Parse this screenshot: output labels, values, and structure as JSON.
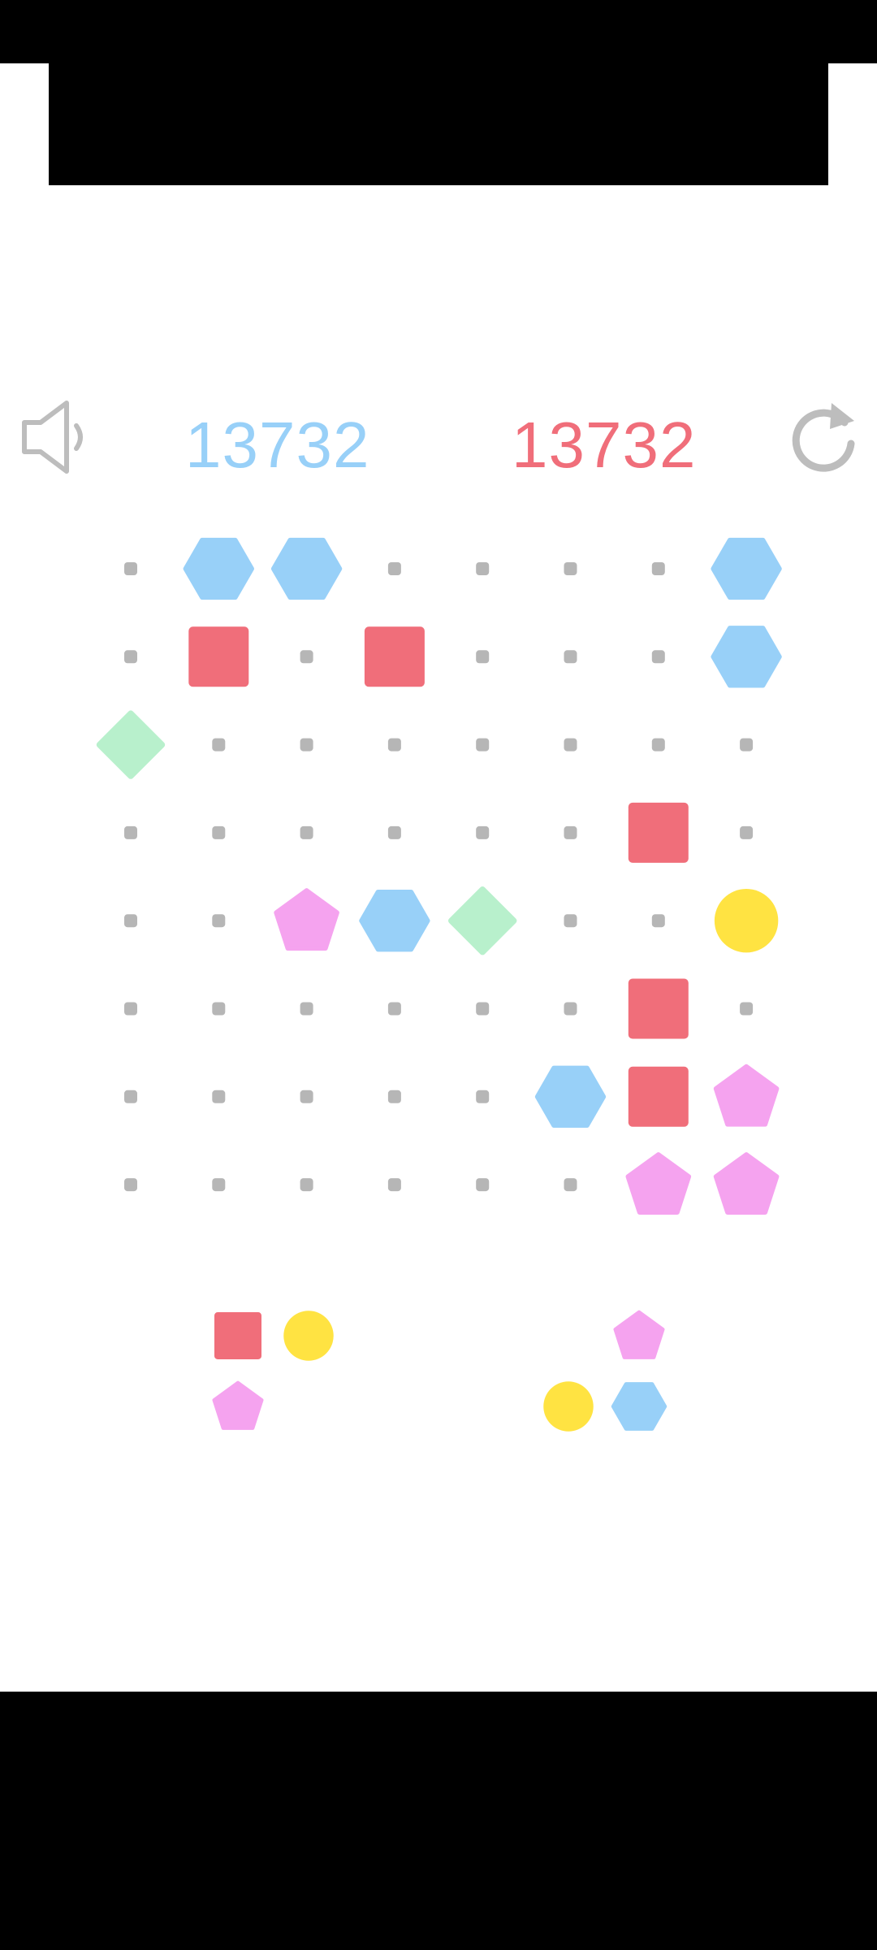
{
  "scores": {
    "current": "13732",
    "best": "13732"
  },
  "controls": {
    "sound_icon": "speaker-muted-icon",
    "restart_icon": "restart-icon"
  },
  "colors": {
    "square": "#f06e7a",
    "hexagon": "#98d0f8",
    "diamond": "#b8f0cc",
    "pentagon": "#f5a3ef",
    "circle": "#ffe342",
    "empty_dot": "#b6b6b6"
  },
  "board": {
    "rows": 8,
    "cols": 8,
    "cells": [
      [
        "empty",
        "hexagon",
        "hexagon",
        "empty",
        "empty",
        "empty",
        "empty",
        "hexagon"
      ],
      [
        "empty",
        "square",
        "empty",
        "square",
        "empty",
        "empty",
        "empty",
        "hexagon"
      ],
      [
        "diamond",
        "empty",
        "empty",
        "empty",
        "empty",
        "empty",
        "empty",
        "empty"
      ],
      [
        "empty",
        "empty",
        "empty",
        "empty",
        "empty",
        "empty",
        "square",
        "empty"
      ],
      [
        "empty",
        "empty",
        "pentagon",
        "hexagon",
        "diamond",
        "empty",
        "empty",
        "circle"
      ],
      [
        "empty",
        "empty",
        "empty",
        "empty",
        "empty",
        "empty",
        "square",
        "empty"
      ],
      [
        "empty",
        "empty",
        "empty",
        "empty",
        "empty",
        "hexagon",
        "square",
        "pentagon"
      ],
      [
        "empty",
        "empty",
        "empty",
        "empty",
        "empty",
        "empty",
        "pentagon",
        "pentagon"
      ]
    ]
  },
  "next_pieces": [
    {
      "name": "piece-left",
      "cells": [
        [
          "square",
          "circle"
        ],
        [
          "pentagon",
          "empty"
        ]
      ]
    },
    {
      "name": "piece-right",
      "cells": [
        [
          "empty",
          "pentagon"
        ],
        [
          "circle",
          "hexagon"
        ]
      ]
    }
  ]
}
